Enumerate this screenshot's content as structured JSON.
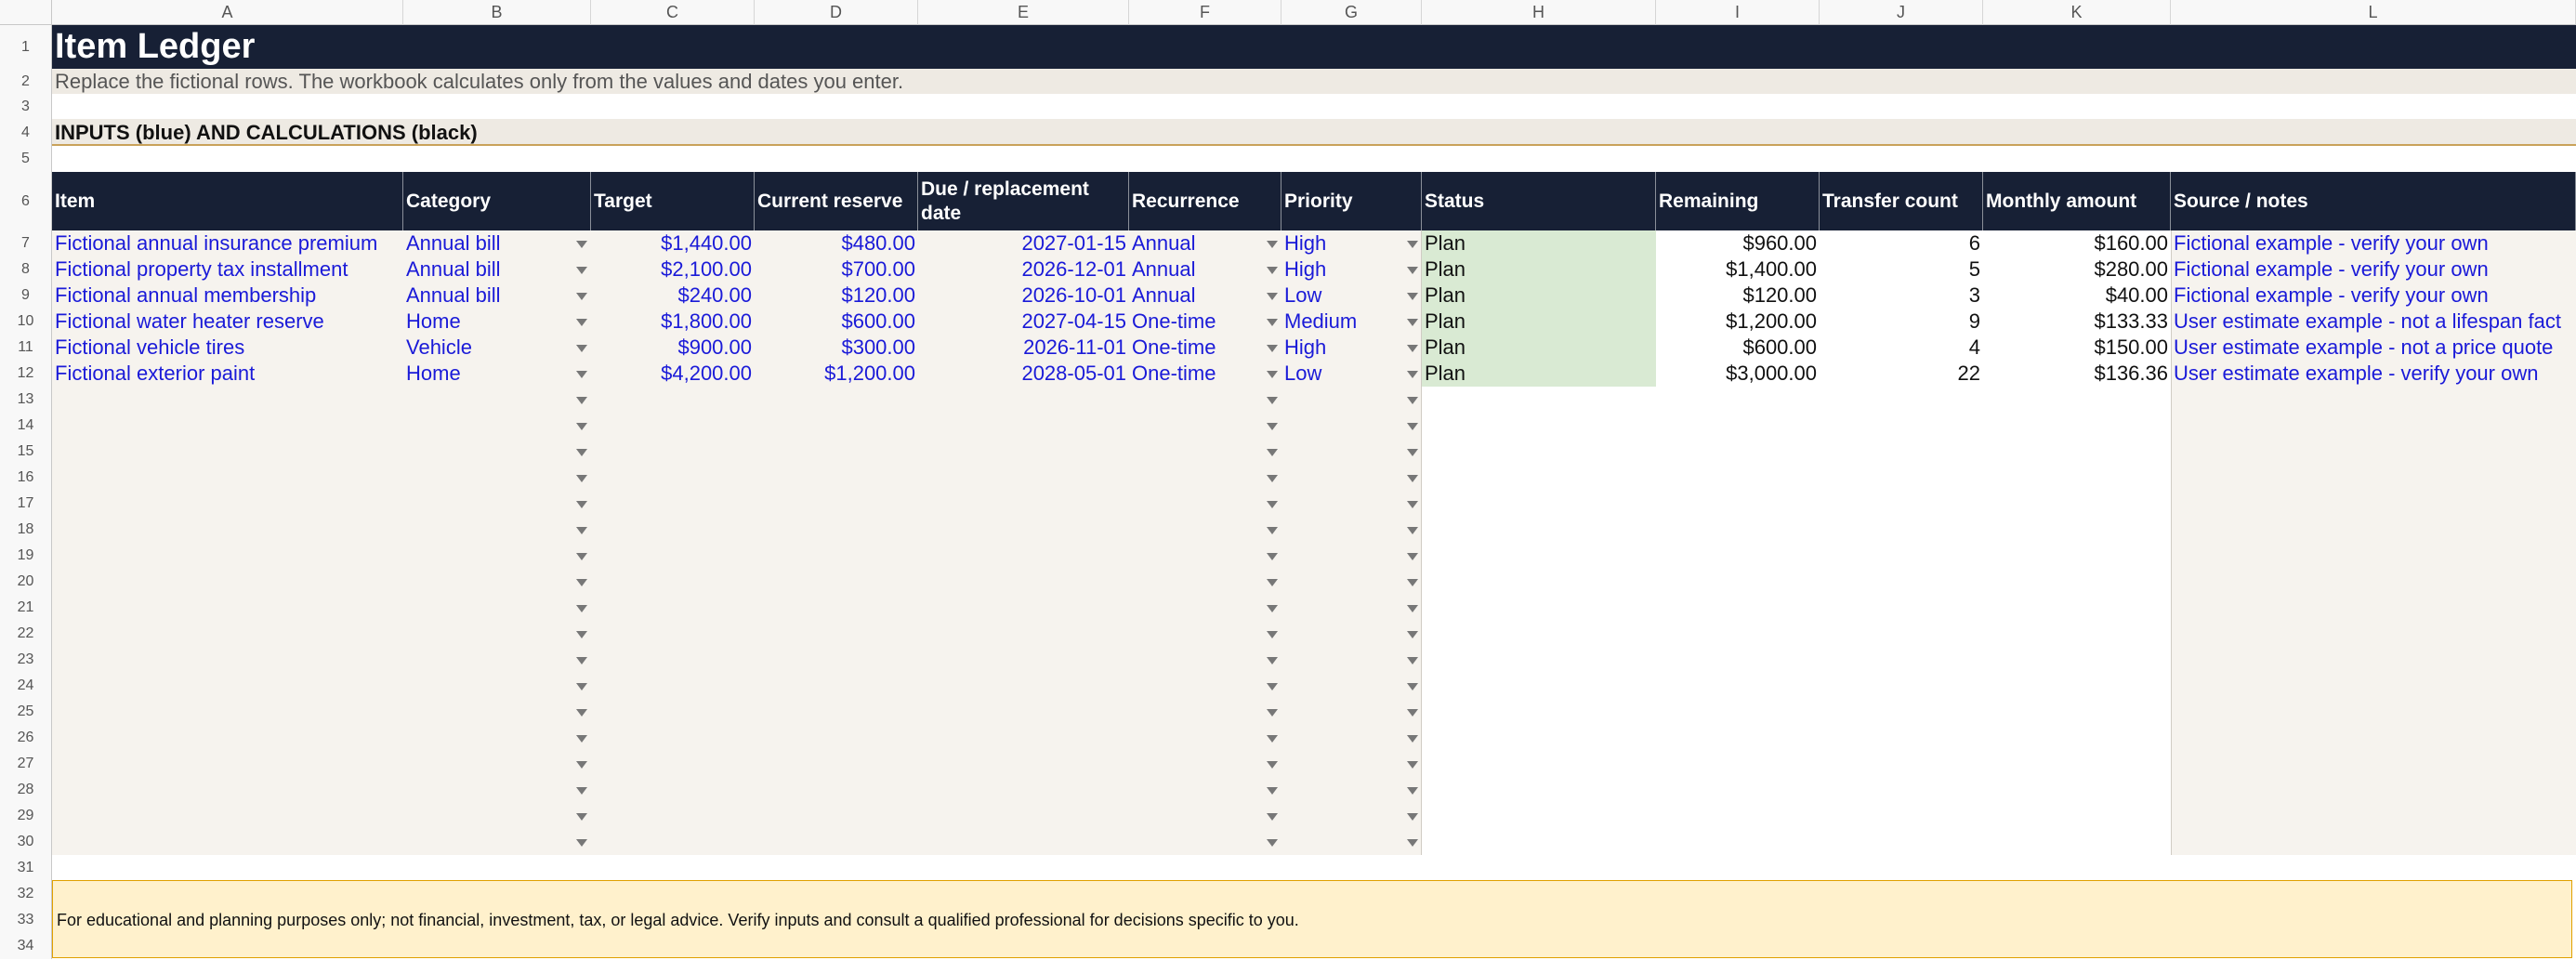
{
  "columns": [
    "A",
    "B",
    "C",
    "D",
    "E",
    "F",
    "G",
    "H",
    "I",
    "J",
    "K",
    "L"
  ],
  "row_numbers": [
    "1",
    "2",
    "3",
    "4",
    "5",
    "6",
    "7",
    "8",
    "9",
    "10",
    "11",
    "12",
    "13",
    "14",
    "15",
    "16",
    "17",
    "18",
    "19",
    "20",
    "21",
    "22",
    "23",
    "24",
    "25",
    "26",
    "27",
    "28",
    "29",
    "30",
    "31",
    "32",
    "33",
    "34"
  ],
  "title": "Item Ledger",
  "subtitle": "Replace the fictional rows. The workbook calculates only from the values and dates you enter.",
  "section_heading": "INPUTS (blue) AND CALCULATIONS (black)",
  "headers": [
    "Item",
    "Category",
    "Target",
    "Current reserve",
    "Due / replacement date",
    "Recurrence",
    "Priority",
    "Status",
    "Remaining",
    "Transfer count",
    "Monthly amount",
    "Source / notes"
  ],
  "rows": [
    {
      "item": "Fictional annual insurance premium",
      "category": "Annual bill",
      "target": "$1,440.00",
      "reserve": "$480.00",
      "due": "2027-01-15",
      "recurrence": "Annual",
      "priority": "High",
      "status": "Plan",
      "remaining": "$960.00",
      "transfers": "6",
      "monthly": "$160.00",
      "notes": "Fictional example - verify your own"
    },
    {
      "item": "Fictional property tax installment",
      "category": "Annual bill",
      "target": "$2,100.00",
      "reserve": "$700.00",
      "due": "2026-12-01",
      "recurrence": "Annual",
      "priority": "High",
      "status": "Plan",
      "remaining": "$1,400.00",
      "transfers": "5",
      "monthly": "$280.00",
      "notes": "Fictional example - verify your own"
    },
    {
      "item": "Fictional annual membership",
      "category": "Annual bill",
      "target": "$240.00",
      "reserve": "$120.00",
      "due": "2026-10-01",
      "recurrence": "Annual",
      "priority": "Low",
      "status": "Plan",
      "remaining": "$120.00",
      "transfers": "3",
      "monthly": "$40.00",
      "notes": "Fictional example - verify your own"
    },
    {
      "item": "Fictional water heater reserve",
      "category": "Home",
      "target": "$1,800.00",
      "reserve": "$600.00",
      "due": "2027-04-15",
      "recurrence": "One-time",
      "priority": "Medium",
      "status": "Plan",
      "remaining": "$1,200.00",
      "transfers": "9",
      "monthly": "$133.33",
      "notes": "User estimate example - not a lifespan fact"
    },
    {
      "item": "Fictional vehicle tires",
      "category": "Vehicle",
      "target": "$900.00",
      "reserve": "$300.00",
      "due": "2026-11-01",
      "recurrence": "One-time",
      "priority": "High",
      "status": "Plan",
      "remaining": "$600.00",
      "transfers": "4",
      "monthly": "$150.00",
      "notes": "User estimate example - not a price quote"
    },
    {
      "item": "Fictional exterior paint",
      "category": "Home",
      "target": "$4,200.00",
      "reserve": "$1,200.00",
      "due": "2028-05-01",
      "recurrence": "One-time",
      "priority": "Low",
      "status": "Plan",
      "remaining": "$3,000.00",
      "transfers": "22",
      "monthly": "$136.36",
      "notes": "User estimate example - verify your own"
    }
  ],
  "disclaimer": "For educational and planning purposes only; not financial, investment, tax, or legal advice. Verify inputs and consult a qualified professional for decisions specific to you.",
  "colors": {
    "navy": "#172035",
    "beige": "#eeeae3",
    "input_fill": "#f6f3ee",
    "status_fill": "#d9ead3",
    "input_text": "#1a1ad8",
    "disclaimer_fill": "#fff1cc",
    "disclaimer_border": "#e0a000"
  }
}
